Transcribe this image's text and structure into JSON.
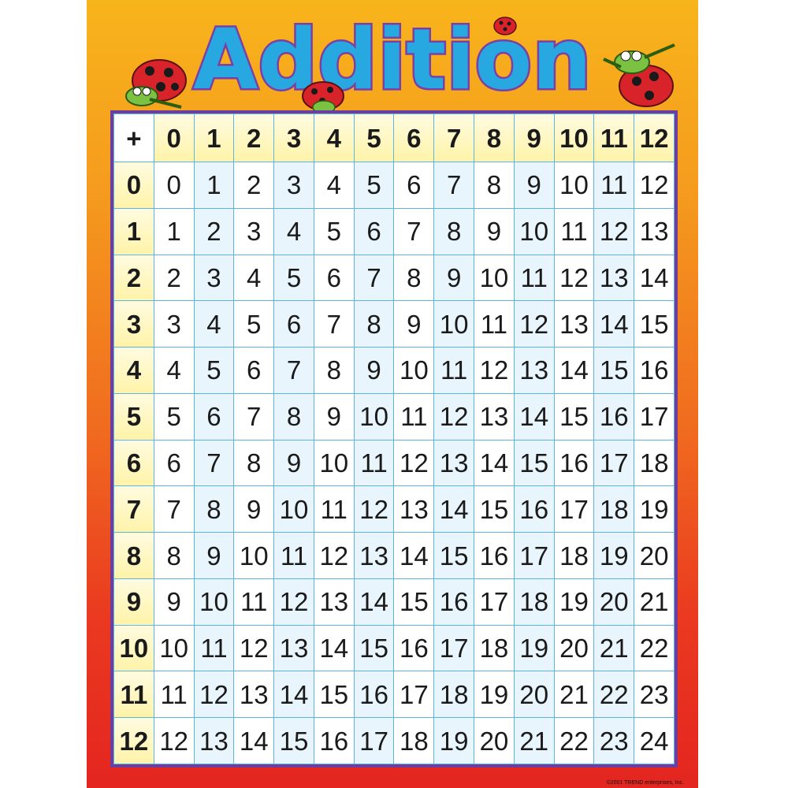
{
  "title": "Addition",
  "table": {
    "corner": "+",
    "columns": [
      "0",
      "1",
      "2",
      "3",
      "4",
      "5",
      "6",
      "7",
      "8",
      "9",
      "10",
      "11",
      "12"
    ],
    "rows": [
      {
        "label": "0",
        "cells": [
          "0",
          "1",
          "2",
          "3",
          "4",
          "5",
          "6",
          "7",
          "8",
          "9",
          "10",
          "11",
          "12"
        ]
      },
      {
        "label": "1",
        "cells": [
          "1",
          "2",
          "3",
          "4",
          "5",
          "6",
          "7",
          "8",
          "9",
          "10",
          "11",
          "12",
          "13"
        ]
      },
      {
        "label": "2",
        "cells": [
          "2",
          "3",
          "4",
          "5",
          "6",
          "7",
          "8",
          "9",
          "10",
          "11",
          "12",
          "13",
          "14"
        ]
      },
      {
        "label": "3",
        "cells": [
          "3",
          "4",
          "5",
          "6",
          "7",
          "8",
          "9",
          "10",
          "11",
          "12",
          "13",
          "14",
          "15"
        ]
      },
      {
        "label": "4",
        "cells": [
          "4",
          "5",
          "6",
          "7",
          "8",
          "9",
          "10",
          "11",
          "12",
          "13",
          "14",
          "15",
          "16"
        ]
      },
      {
        "label": "5",
        "cells": [
          "5",
          "6",
          "7",
          "8",
          "9",
          "10",
          "11",
          "12",
          "13",
          "14",
          "15",
          "16",
          "17"
        ]
      },
      {
        "label": "6",
        "cells": [
          "6",
          "7",
          "8",
          "9",
          "10",
          "11",
          "12",
          "13",
          "14",
          "15",
          "16",
          "17",
          "18"
        ]
      },
      {
        "label": "7",
        "cells": [
          "7",
          "8",
          "9",
          "10",
          "11",
          "12",
          "13",
          "14",
          "15",
          "16",
          "17",
          "18",
          "19"
        ]
      },
      {
        "label": "8",
        "cells": [
          "8",
          "9",
          "10",
          "11",
          "12",
          "13",
          "14",
          "15",
          "16",
          "17",
          "18",
          "19",
          "20"
        ]
      },
      {
        "label": "9",
        "cells": [
          "9",
          "10",
          "11",
          "12",
          "13",
          "14",
          "15",
          "16",
          "17",
          "18",
          "19",
          "20",
          "21"
        ]
      },
      {
        "label": "10",
        "cells": [
          "10",
          "11",
          "12",
          "13",
          "14",
          "15",
          "16",
          "17",
          "18",
          "19",
          "20",
          "21",
          "22"
        ]
      },
      {
        "label": "11",
        "cells": [
          "11",
          "12",
          "13",
          "14",
          "15",
          "16",
          "17",
          "18",
          "19",
          "20",
          "21",
          "22",
          "23"
        ]
      },
      {
        "label": "12",
        "cells": [
          "12",
          "13",
          "14",
          "15",
          "16",
          "17",
          "18",
          "19",
          "20",
          "21",
          "22",
          "23",
          "24"
        ]
      }
    ]
  },
  "copyright": "©2001 TREND enterprises, Inc.",
  "colors": {
    "title_fill": "#27a8e0",
    "title_outline": "#7b3fa6",
    "header_bg": "#fff3a8",
    "grid_line": "#5cb4e0",
    "frame": "#6a3fa0",
    "ladybug_red": "#d8232a",
    "bug_green": "#7cc242"
  },
  "icons": [
    "ladybug-icon",
    "grasshopper-icon"
  ]
}
